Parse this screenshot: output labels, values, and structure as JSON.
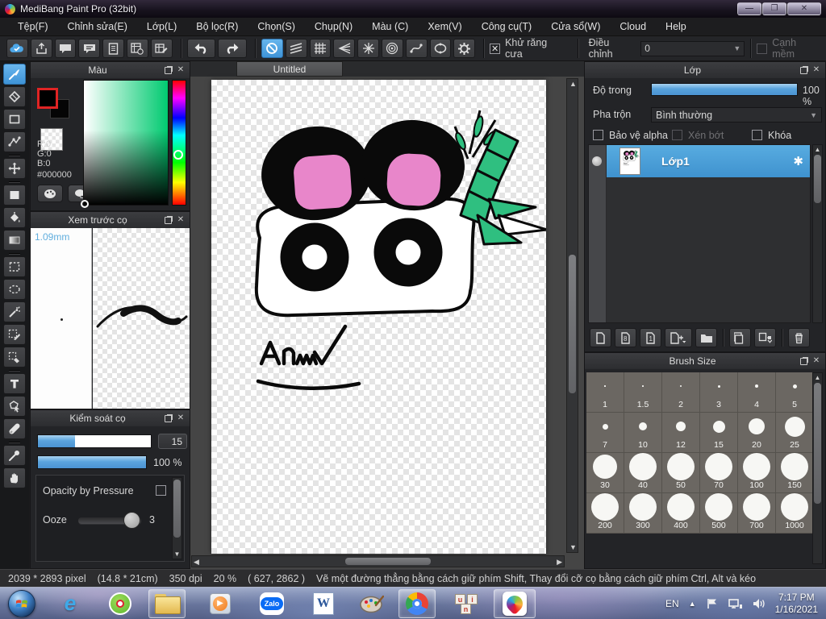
{
  "window": {
    "title": "MediBang Paint Pro (32bit)",
    "controls": {
      "minimize": "—",
      "restore": "❐",
      "close": "✕"
    }
  },
  "menu": {
    "items": [
      "Tệp(F)",
      "Chỉnh sửa(E)",
      "Lớp(L)",
      "Bộ lọc(R)",
      "Chọn(S)",
      "Chụp(N)",
      "Màu (C)",
      "Xem(V)",
      "Công cụ(T)",
      "Cửa sổ(W)",
      "Cloud",
      "Help"
    ]
  },
  "toolbar": {
    "antialias_label": "Khử răng cưa",
    "adjust_label": "Điều chỉnh",
    "adjust_value": "0",
    "soft_edge_label": "Cạnh mềm"
  },
  "color_panel": {
    "title": "Màu",
    "r": "R:0",
    "g": "G:0",
    "b": "B:0",
    "hex": "#000000"
  },
  "brush_preview_panel": {
    "title": "Xem trước cọ",
    "size_label": "1.09mm"
  },
  "brush_control_panel": {
    "title": "Kiểm soát cọ",
    "size_value": "15",
    "opacity_value": "100 %",
    "pressure_label": "Opacity by Pressure",
    "ooze_label": "Ooze",
    "ooze_value": "3"
  },
  "canvas": {
    "tab": "Untitled"
  },
  "layer_panel": {
    "title": "Lớp",
    "opacity_label": "Độ trong",
    "opacity_value": "100 %",
    "blend_label": "Pha trộn",
    "blend_value": "Bình thường",
    "alpha_label": "Bảo vệ alpha",
    "clip_label": "Xén bớt",
    "lock_label": "Khóa",
    "layers": [
      {
        "name": "Lớp1"
      }
    ]
  },
  "brush_size_panel": {
    "title": "Brush Size",
    "sizes": [
      "1",
      "1.5",
      "2",
      "3",
      "4",
      "5",
      "7",
      "10",
      "12",
      "15",
      "20",
      "25",
      "30",
      "40",
      "50",
      "70",
      "100",
      "150",
      "200",
      "300",
      "400",
      "500",
      "700",
      "1000"
    ]
  },
  "status_bar": {
    "dimensions": "2039 * 2893 pixel",
    "print_size": "(14.8 * 21cm)",
    "dpi": "350 dpi",
    "zoom": "20 %",
    "cursor": "( 627, 2862 )",
    "hint": "Vẽ một đường thẳng bằng cách giữ phím Shift, Thay đổi cỡ cọ bằng cách giữ phím Ctrl, Alt và kéo"
  },
  "taskbar": {
    "zalo_label": "Zalo",
    "tray": {
      "lang": "EN",
      "time": "7:17 PM",
      "date": "1/16/2021"
    }
  },
  "colors": {
    "accent_blue": "#4da3e0",
    "selected_layer": "#4a9fd8",
    "drawing_pink": "#e886ca",
    "drawing_green": "#2fbf80",
    "foreground": "#000000"
  }
}
